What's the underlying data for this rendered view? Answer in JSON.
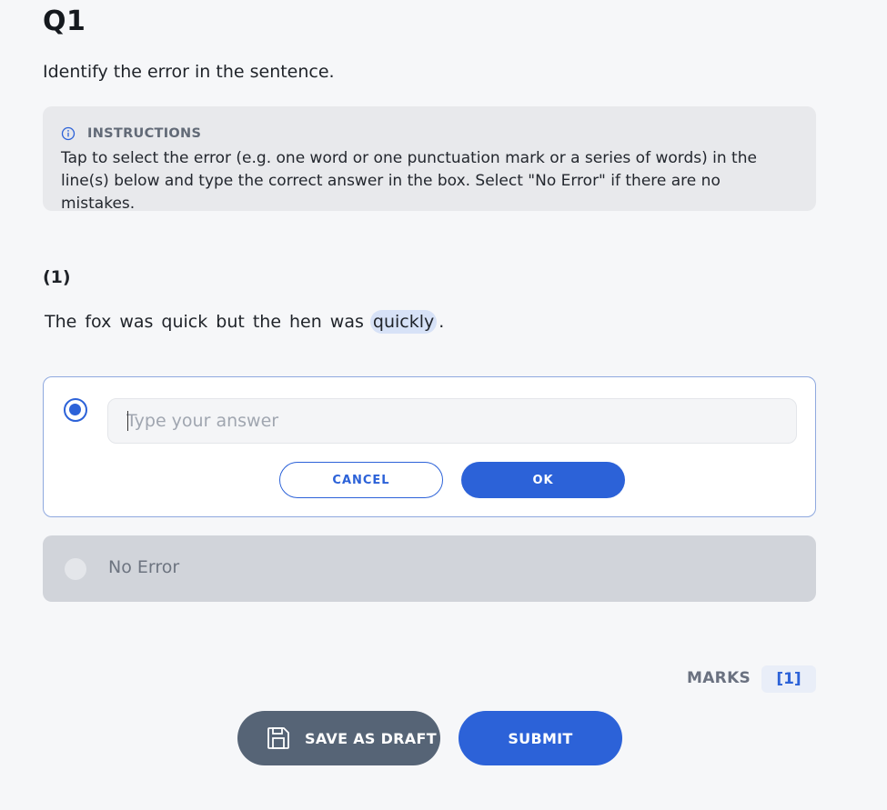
{
  "question": {
    "title": "Q1",
    "prompt": "Identify the error in the sentence."
  },
  "instructions": {
    "icon": "info-icon",
    "label": "INSTRUCTIONS",
    "text": "Tap to select the error (e.g. one word or one punctuation mark or a series of words) in the line(s) below and type the correct answer in the box. Select \"No Error\" if there are no mistakes."
  },
  "part": {
    "label": "(1)",
    "words": [
      "The",
      "fox",
      "was",
      "quick",
      "but",
      "the",
      "hen",
      "was",
      "quickly",
      "."
    ],
    "selected_word": "quickly"
  },
  "answer": {
    "placeholder": "Type your answer",
    "value": "",
    "cancel_label": "CANCEL",
    "ok_label": "OK",
    "selected": true
  },
  "no_error": {
    "label": "No Error",
    "selected": false
  },
  "marks": {
    "label": "MARKS",
    "value": "[1]"
  },
  "footer": {
    "save_icon": "save-icon",
    "save_draft_label": "SAVE AS DRAFT",
    "submit_label": "SUBMIT"
  },
  "colors": {
    "accent": "#2c62d8",
    "draft_button": "#566476",
    "selection_highlight": "#d7e2f7"
  }
}
